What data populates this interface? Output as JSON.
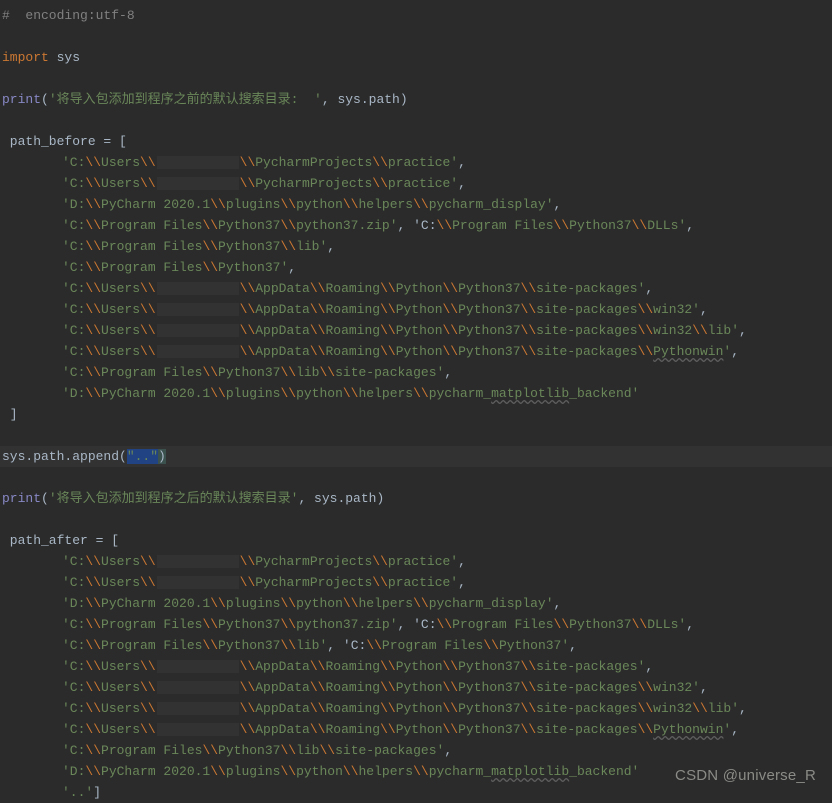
{
  "code": {
    "l1": "#  encoding:utf-8",
    "l2_import": "import",
    "l2_sys": " sys",
    "l3_print": "print",
    "l3_str": "'将导入包添加到程序之前的默认搜索目录:  '",
    "l3_suffix": ", sys.path)",
    "l4_var": " path_before = [",
    "before": {
      "r1a": "'C:",
      "r1b": "Users",
      "r1c": "\\\\",
      "r1d": "PycharmProjects",
      "r1e": "practice'",
      "r3a": "'D:",
      "r3b": "PyCharm 2020.1",
      "r3c": "plugins",
      "r3d": "python",
      "r3e": "helpers",
      "r3f": "pycharm_display'",
      "r4a": "'C:",
      "r4b": "Program Files",
      "r4c": "Python37",
      "r4d": "python37.zip'",
      "r4e": ", 'C:",
      "r4f": "Program Files",
      "r4g": "Python37",
      "r4h": "DLLs'",
      "r5a": "'C:",
      "r5b": "Program Files",
      "r5c": "Python37",
      "r5d": "lib'",
      "r6a": "'C:",
      "r6b": "Program Files",
      "r6c": "Python37'",
      "r7a": "'C:",
      "r7b": "Users",
      "r7c": "AppData",
      "r7d": "Roaming",
      "r7e": "Python",
      "r7f": "Python37",
      "r7g": "site-packages'",
      "r8g": "site-packages",
      "r8h": "win32'",
      "r9h": "win32",
      "r9i": "lib'",
      "r10g": "site-packages",
      "r10h": "Pythonwin",
      "r11a": "'C:",
      "r11b": "Program Files",
      "r11c": "Python37",
      "r11d": "lib",
      "r11e": "site-packages'",
      "r12a": "'D:",
      "r12b": "PyCharm 2020.1",
      "r12c": "plugins",
      "r12d": "python",
      "r12e": "helpers",
      "r12f": "pycharm_",
      "r12g": "matplotlib",
      "r12h": "_backend'"
    },
    "close_bracket": " ]",
    "append_line_a": "sys.path.append(",
    "append_str": "\"..\"",
    "append_line_b": ")",
    "l_after_print_str": "'将导入包添加到程序之后的默认搜索目录'",
    "l_after_var": " path_after = [",
    "after_last": "'..'",
    "after_close": "]"
  },
  "watermark": "CSDN @universe_R"
}
